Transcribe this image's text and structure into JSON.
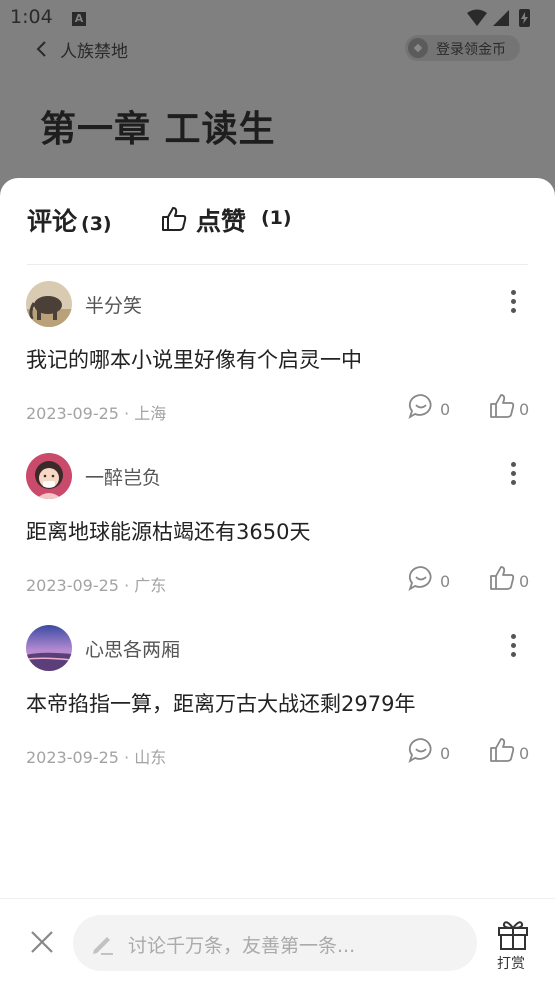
{
  "status_bar": {
    "time": "1:04",
    "notif_letter": "A"
  },
  "header": {
    "book_title": "人族禁地",
    "login_label": "登录领金币"
  },
  "chapter_title": "第一章 工读生",
  "tabs": {
    "comment_label": "评论",
    "comment_count": "(3)",
    "like_label": "点赞",
    "like_count": "(1)"
  },
  "comments": [
    {
      "user": "半分笑",
      "text": "我记的哪本小说里好像有个启灵一中",
      "meta": "2023-09-25 · 上海",
      "replies": "0",
      "likes": "0"
    },
    {
      "user": "一醉岂负",
      "text": "距离地球能源枯竭还有3650天",
      "meta": "2023-09-25 · 广东",
      "replies": "0",
      "likes": "0"
    },
    {
      "user": "心思各两厢",
      "text": "本帝掐指一算，距离万古大战还剩2979年",
      "meta": "2023-09-25 · 山东",
      "replies": "0",
      "likes": "0"
    }
  ],
  "bottom": {
    "placeholder": "讨论千万条，友善第一条...",
    "tip_label": "打赏"
  },
  "icons": [
    "back-icon",
    "coin-icon",
    "thumb-up-icon",
    "more-icon",
    "comment-bubble-icon",
    "close-icon",
    "pencil-icon",
    "gift-icon"
  ]
}
